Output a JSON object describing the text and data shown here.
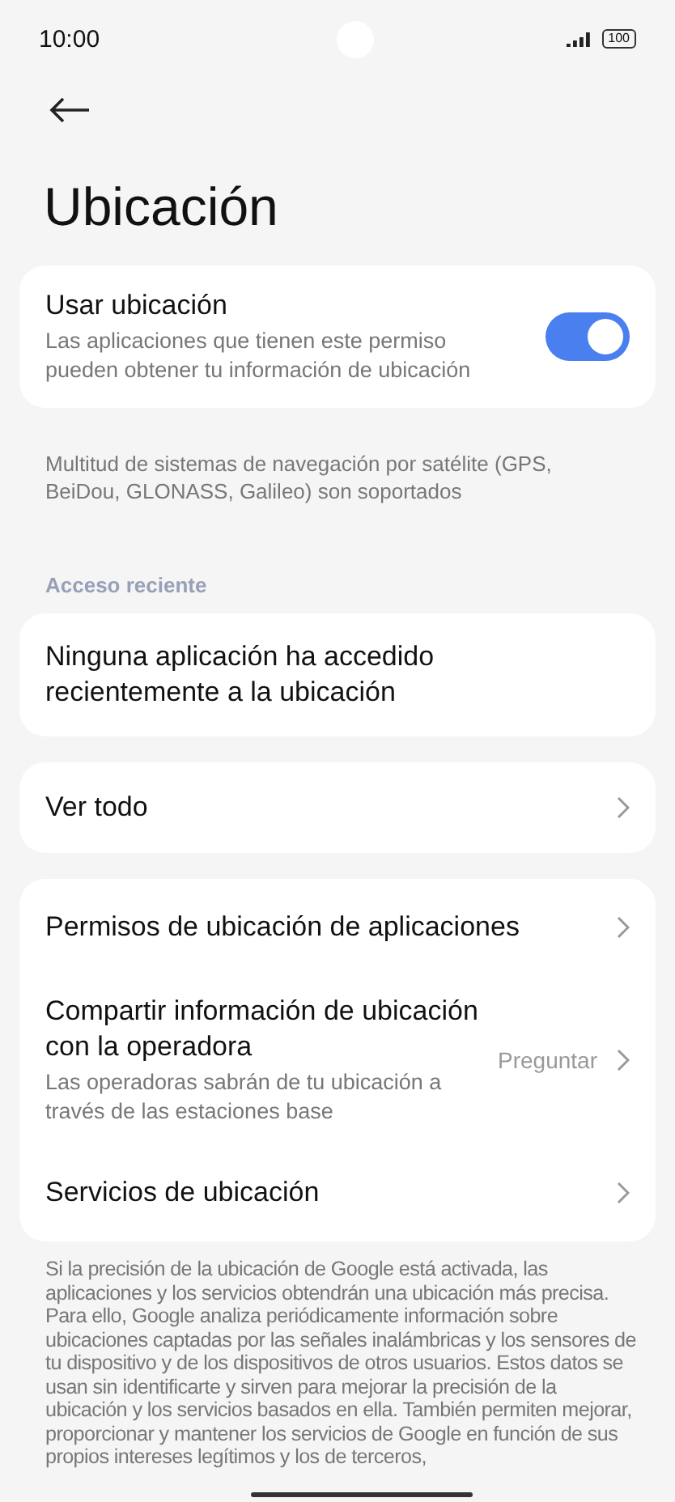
{
  "status_bar": {
    "time": "10:00",
    "battery": "100"
  },
  "title": "Ubicación",
  "location_toggle": {
    "label": "Usar ubicación",
    "description": "Las aplicaciones que tienen este permiso pueden obtener tu información de ubicación",
    "on": true
  },
  "gnss_note": "Multitud de sistemas de navegación por satélite (GPS, BeiDou, GLONASS, Galileo) son soportados",
  "recent_access": {
    "header": "Acceso reciente",
    "message": "Ninguna aplicación ha accedido recientemente a la ubicación"
  },
  "see_all": {
    "label": "Ver todo"
  },
  "settings": [
    {
      "label": "Permisos de ubicación de aplicaciones"
    },
    {
      "label": "Compartir información de ubicación con la operadora",
      "description": "Las operadoras sabrán de tu ubicación a través de las estaciones base",
      "value": "Preguntar"
    },
    {
      "label": "Servicios de ubicación"
    }
  ],
  "footer_text": "Si la precisión de la ubicación de Google está activada, las aplicaciones y los servicios obtendrán una ubicación más precisa. Para ello, Google analiza periódicamente información sobre ubicaciones captadas por las señales inalámbricas y los sensores de tu dispositivo y de los dispositivos de otros usuarios. Estos datos se usan sin identificarte y sirven para mejorar la precisión de la ubicación y los servicios basados en ella. También permiten mejorar, proporcionar y mantener los servicios de Google en función de sus propios intereses legítimos y los de terceros,"
}
